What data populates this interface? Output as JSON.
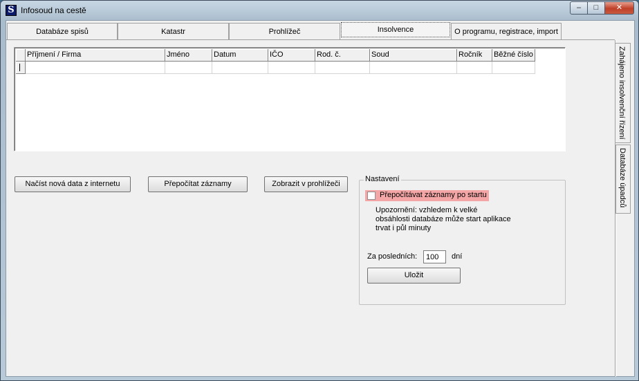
{
  "window": {
    "title": "Infosoud na cestě",
    "controls": {
      "minimize": "–",
      "maximize": "□",
      "close": "✕"
    }
  },
  "tabs": [
    {
      "label": "Databáze spisů",
      "active": false
    },
    {
      "label": "Katastr",
      "active": false
    },
    {
      "label": "Prohlížeč",
      "active": false
    },
    {
      "label": "Insolvence",
      "active": true
    },
    {
      "label": "O programu, registrace, import",
      "active": false
    }
  ],
  "side_tabs": [
    {
      "label": "Zahájeno insolvenční řízení",
      "active": true
    },
    {
      "label": "Databáze úpadců",
      "active": false
    }
  ],
  "grid": {
    "columns": [
      "Příjmení / Firma",
      "Jméno",
      "Datum",
      "IČO",
      "Rod. č.",
      "Soud",
      "Ročník",
      "Běžné číslo"
    ],
    "rows": [
      [
        "",
        "",
        "",
        "",
        "",
        "",
        "",
        ""
      ]
    ]
  },
  "buttons": {
    "load": "Načíst nová data z internetu",
    "recalc": "Přepočítat záznamy",
    "show": "Zobrazit v prohlížeči"
  },
  "settings": {
    "legend": "Nastavení",
    "recalc_on_start": {
      "label": "Přepočítávat záznamy po startu",
      "checked": false
    },
    "warning_lines": [
      "Upozornění: vzhledem k velké",
      "obsáhlosti databáze může start aplikace",
      "trvat i půl minuty"
    ],
    "period_label": "Za posledních:",
    "period_value": "100",
    "period_unit": "dní",
    "save_label": "Uložit"
  }
}
